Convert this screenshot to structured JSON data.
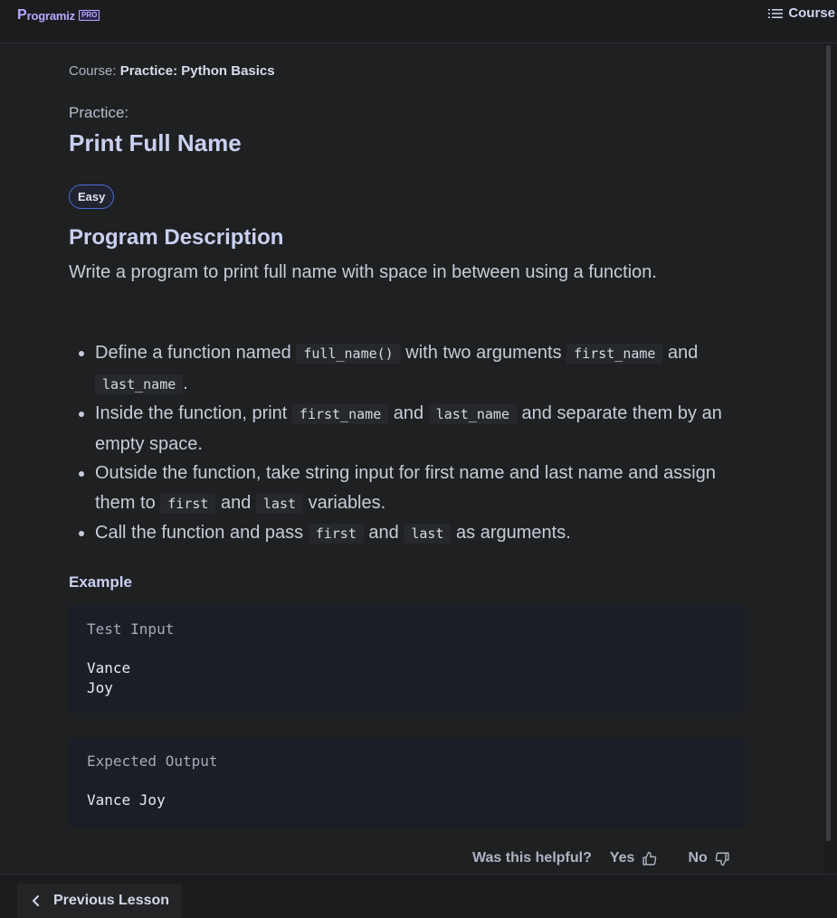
{
  "header": {
    "logo_text": "rogramiz",
    "logo_p": "P",
    "pro_badge": "PRO",
    "course_menu_label": "Course"
  },
  "breadcrumb": {
    "prefix": "Course: ",
    "course": "Practice: Python Basics"
  },
  "lesson": {
    "kicker": "Practice:",
    "title": "Print Full Name",
    "difficulty": "Easy"
  },
  "description": {
    "heading": "Program Description",
    "text": "Write a program to print full name with space in between using a function.",
    "items": [
      {
        "t1": "Define a function named ",
        "c1": "full_name()",
        "t2": " with two arguments ",
        "c2": "first_name",
        "t3": " and ",
        "c3": "last_name",
        "t4": "."
      },
      {
        "t1": "Inside the function, print ",
        "c1": "first_name",
        "t2": " and ",
        "c2": "last_name",
        "t3": " and separate them by an empty space."
      },
      {
        "t1": "Outside the function, take string input for first name and last name and assign them to ",
        "c1": "first",
        "t2": " and ",
        "c2": "last",
        "t3": " variables."
      },
      {
        "t1": "Call the function and pass ",
        "c1": "first",
        "t2": " and ",
        "c2": "last",
        "t3": " as arguments."
      }
    ]
  },
  "example": {
    "heading": "Example",
    "input_label": "Test Input",
    "input_value": "Vance\nJoy",
    "output_label": "Expected Output",
    "output_value": "Vance Joy"
  },
  "feedback": {
    "question": "Was this helpful?",
    "yes": "Yes",
    "no": "No"
  },
  "footer": {
    "prev_label": "Previous Lesson"
  },
  "icons": {
    "menu": "list-menu-icon",
    "thumbs_up": "thumbs-up-icon",
    "thumbs_down": "thumbs-down-icon",
    "prev": "chevron-left-icon"
  },
  "colors": {
    "background": "#1f2022",
    "heading": "#c9d0f0",
    "accent": "#b8a8ff",
    "badge_border": "#4d6bd8",
    "codebox": "#1b1d27"
  }
}
